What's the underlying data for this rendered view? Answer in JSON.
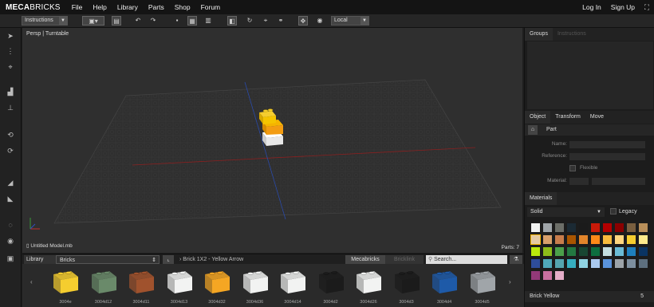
{
  "app": {
    "logo_bold": "MECA",
    "logo_rest": "BRICKS",
    "menu": [
      "File",
      "Help",
      "Library",
      "Parts",
      "Shop",
      "Forum"
    ],
    "login": "Log In",
    "signup": "Sign Up"
  },
  "toolbar": {
    "mode": "Instructions",
    "space": "Local"
  },
  "viewport": {
    "view_label": "Persp | Turntable",
    "file_name": "Untitled Model.mb",
    "parts_count": "Parts: 7"
  },
  "right": {
    "tabs_top": [
      "Groups",
      "Instructions"
    ],
    "tabs_mid": [
      "Object",
      "Transform",
      "Move"
    ],
    "part_label": "Part",
    "fields": [
      "Name:",
      "Reference:",
      "Flexible",
      "Material:"
    ],
    "materials_tab": "Materials",
    "solid": "Solid",
    "legacy": "Legacy",
    "selected_color": "Brick Yellow",
    "selected_count": "5",
    "swatch_colors": [
      "#f2f3f2",
      "#a0a5a9",
      "#6c6e68",
      "#1b2a34",
      "#1b1b1b",
      "#c91a09",
      "#b40000",
      "#8a0000",
      "#7a5f3f",
      "#b88f5a",
      "#e3c9a2",
      "#d8a06b",
      "#c87d4c",
      "#a95500",
      "#e3852b",
      "#fe8a18",
      "#f8bb3d",
      "#ffd67f",
      "#f5cd2f",
      "#fdea8c",
      "#bbe90b",
      "#8ebc1a",
      "#4b9f4a",
      "#237841",
      "#184632",
      "#0d6e3f",
      "#c4dde0",
      "#6bbcd6",
      "#1e7fbc",
      "#0a3463",
      "#2e4d9b",
      "#4fa9b9",
      "#55a5af",
      "#36aebf",
      "#8fd3e2",
      "#aac9ef",
      "#5a93db",
      "#9ca3a8",
      "#7d8f9f",
      "#5d6f7f",
      "#923978",
      "#c870a0",
      "#e4adc8"
    ]
  },
  "library": {
    "library_label": "Library",
    "category": "Bricks",
    "part_path": "Brick 1X2 - Yellow Arrow",
    "source_active": "Mecabricks",
    "source_inactive": "Bricklink",
    "search_placeholder": "Search...",
    "parts": [
      {
        "id": "3004e",
        "color": "#f5cd2f"
      },
      {
        "id": "3004d12",
        "color": "#6a8a6a"
      },
      {
        "id": "3004d11",
        "color": "#a0522d"
      },
      {
        "id": "3004d13",
        "color": "#f2f3f2"
      },
      {
        "id": "3004d32",
        "color": "#f5a623"
      },
      {
        "id": "3004d36",
        "color": "#f2f3f2"
      },
      {
        "id": "3004d14",
        "color": "#f2f3f2"
      },
      {
        "id": "3004d2",
        "color": "#1b1b1b"
      },
      {
        "id": "3004d26",
        "color": "#f2f3f2"
      },
      {
        "id": "3004d3",
        "color": "#1b1b1b"
      },
      {
        "id": "3004d4",
        "color": "#1e5aa8"
      },
      {
        "id": "3004d5",
        "color": "#a0a5a9"
      }
    ]
  },
  "colors": {
    "accent": "#f5b400"
  }
}
